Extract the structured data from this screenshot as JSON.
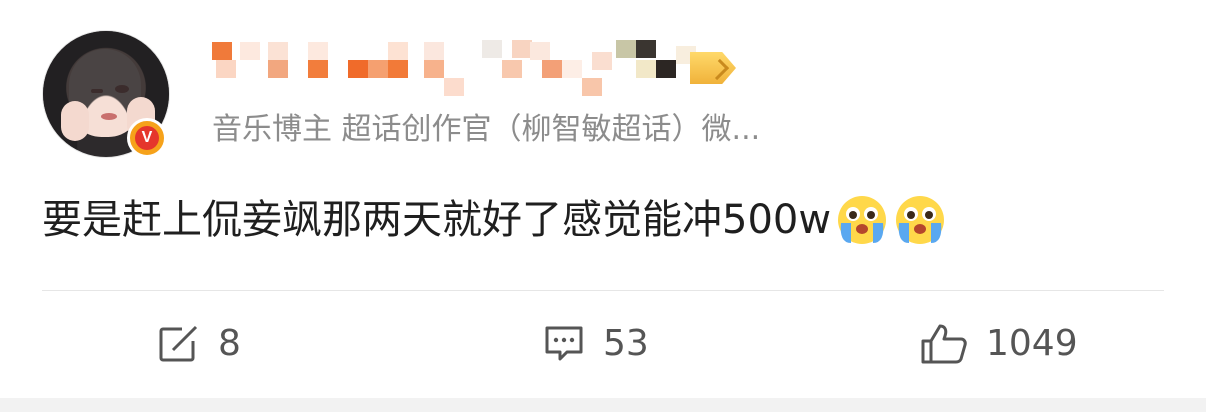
{
  "post": {
    "user": {
      "verified_badge_letter": "V",
      "subtitle": "音乐博主 超话创作官（柳智敏超话）微..."
    },
    "content": {
      "text": "要是赶上侃妾飒那两天就好了感觉能冲500w",
      "emojis": [
        "crying-emoji",
        "crying-emoji"
      ]
    },
    "actions": {
      "repost_count": "8",
      "comment_count": "53",
      "like_count": "1049"
    }
  },
  "colors": {
    "badge_orange": "#f6a21a",
    "badge_red": "#e5362c",
    "mosaic_orange": "#f07a3a",
    "text_primary": "#1f1f1f",
    "text_secondary": "#8c8c8c"
  },
  "icons": {
    "repost": "edit-square-icon",
    "comment": "comment-icon",
    "like": "thumbs-up-icon"
  }
}
